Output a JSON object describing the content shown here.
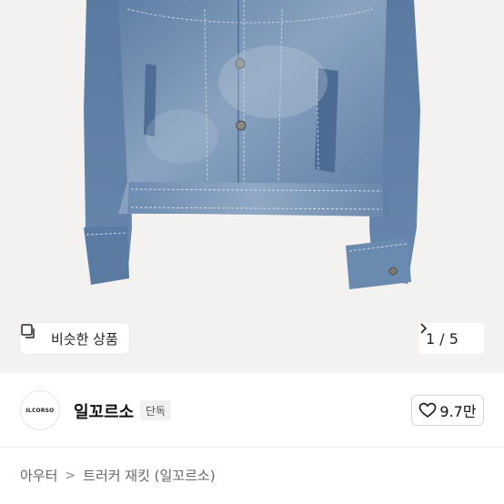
{
  "gallery": {
    "similar_label": "비슷한 상품",
    "pager_current": "1",
    "pager_total": "5",
    "pager_text": "1 / 5"
  },
  "seller": {
    "logo_text": "ILCORSO",
    "name": "일꼬르소",
    "badge": "단독",
    "like_count": "9.7만"
  },
  "breadcrumb": {
    "category": "아우터",
    "separator": ">",
    "product": "트러커 재킷 (일꼬르소)"
  },
  "colors": {
    "gallery_bg": "#f3f2f0",
    "denim": "#6f8db0",
    "text": "#111111"
  }
}
